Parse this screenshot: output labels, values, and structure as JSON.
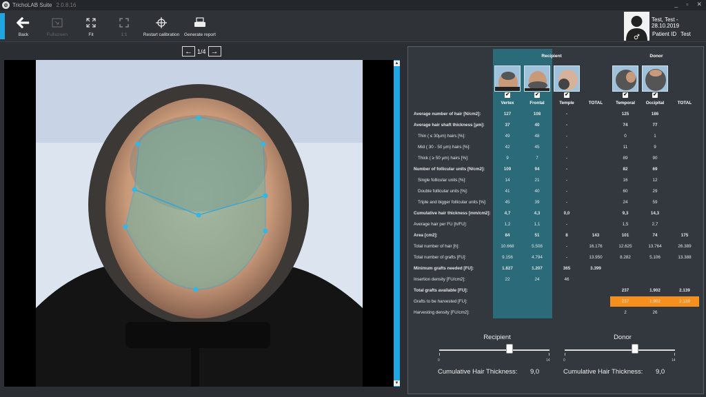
{
  "window": {
    "title": "TrichoLAB Suite",
    "version": "2.0.8.16",
    "controls": [
      "_",
      "▫",
      "✕"
    ]
  },
  "toolbar": {
    "back": "Back",
    "fullscreen": "Fullscreen",
    "fit": "Fit",
    "one_to_one": "1:1",
    "restart_calibration": "Restart calibration",
    "generate_report": "Generate report"
  },
  "patient": {
    "name_date": "Test, Test - 28.10.2019",
    "id_label": "Patient ID",
    "id_value": "Test"
  },
  "pager": {
    "text": "1/4"
  },
  "colors": {
    "accent": "#1ea7e0",
    "recipient_col": "#2a6a79",
    "highlight": "#f5901e"
  },
  "table": {
    "recipient_header": "Recipient",
    "donor_header": "Donor",
    "columns": [
      "Vertex",
      "Frontal",
      "Temple",
      "TOTAL",
      "Temporal",
      "Occipital",
      "TOTAL"
    ],
    "checkmarks": [
      "✔",
      "✔",
      "✔",
      "✔",
      "✔"
    ],
    "rows": [
      {
        "label": "Average number of hair [N/cm2]:",
        "bold": true,
        "sub": false,
        "values": [
          "127",
          "108",
          "-",
          "",
          "125",
          "186",
          ""
        ]
      },
      {
        "label": "Average hair shaft thickness [µm]:",
        "bold": true,
        "sub": false,
        "values": [
          "37",
          "40",
          "-",
          "",
          "74",
          "77",
          ""
        ]
      },
      {
        "label": "Thin ( ≤ 30µm) hairs [%]:",
        "bold": false,
        "sub": true,
        "values": [
          "49",
          "48",
          "-",
          "",
          "0",
          "1",
          ""
        ]
      },
      {
        "label": "Mid ( 30 - 50 µm) hairs [%]:",
        "bold": false,
        "sub": true,
        "values": [
          "42",
          "45",
          "-",
          "",
          "11",
          "9",
          ""
        ]
      },
      {
        "label": "Thick ( ≥ 50 µm) hairs [%]:",
        "bold": false,
        "sub": true,
        "values": [
          "9",
          "7",
          "-",
          "",
          "89",
          "90",
          ""
        ]
      },
      {
        "label": "Number of follicular units [N/cm2]:",
        "bold": true,
        "sub": false,
        "values": [
          "109",
          "94",
          "-",
          "",
          "82",
          "69",
          ""
        ]
      },
      {
        "label": "Single follicular units [%]:",
        "bold": false,
        "sub": true,
        "values": [
          "14",
          "21",
          "-",
          "",
          "16",
          "12",
          ""
        ]
      },
      {
        "label": "Double follicular units [%]:",
        "bold": false,
        "sub": true,
        "values": [
          "41",
          "40",
          "-",
          "",
          "60",
          "29",
          ""
        ]
      },
      {
        "label": "Triple and bigger follicular units [%]:",
        "bold": false,
        "sub": true,
        "values": [
          "45",
          "39",
          "-",
          "",
          "24",
          "59",
          ""
        ]
      },
      {
        "label": "Cumulative hair thickness [mm/cm2]:",
        "bold": true,
        "sub": false,
        "values": [
          "4,7",
          "4,3",
          "0,0",
          "",
          "9,3",
          "14,3",
          ""
        ]
      },
      {
        "label": "Average hair per FU [h/FU]:",
        "bold": false,
        "sub": false,
        "values": [
          "1,2",
          "1,1",
          "-",
          "",
          "1,5",
          "2,7",
          ""
        ]
      },
      {
        "label": "Area [cm2]:",
        "bold": true,
        "sub": false,
        "values": [
          "84",
          "51",
          "8",
          "143",
          "101",
          "74",
          "175"
        ]
      },
      {
        "label": "Total number of hair [h]:",
        "bold": false,
        "sub": false,
        "values": [
          "10.668",
          "5.508",
          "-",
          "16.176",
          "12.625",
          "13.764",
          "26.389"
        ]
      },
      {
        "label": "Total number of grafts [FU]:",
        "bold": false,
        "sub": false,
        "values": [
          "9.156",
          "4.794",
          "-",
          "13.950",
          "8.282",
          "5.106",
          "13.388"
        ]
      },
      {
        "label": "Minimum grafts needed [FU]:",
        "bold": true,
        "sub": false,
        "values": [
          "1.827",
          "1.207",
          "365",
          "3.399",
          "",
          "",
          ""
        ]
      },
      {
        "label": "Insertion density [FU/cm2]:",
        "bold": false,
        "sub": false,
        "values": [
          "22",
          "24",
          "46",
          "",
          "",
          "",
          ""
        ]
      },
      {
        "label": "Total grafts available [FU]:",
        "bold": true,
        "sub": false,
        "values": [
          "",
          "",
          "",
          "",
          "237",
          "1.902",
          "2.139"
        ]
      },
      {
        "label": "Grafts to be harvested [FU]:",
        "bold": false,
        "sub": false,
        "values": [
          "",
          "",
          "",
          "",
          "237",
          "1.902",
          "2.139"
        ]
      },
      {
        "label": "Harvesting density [FU/cm2]:",
        "bold": false,
        "sub": false,
        "values": [
          "",
          "",
          "",
          "",
          "2",
          "26",
          ""
        ]
      }
    ]
  },
  "sliders": {
    "recipient": {
      "title": "Recipient",
      "min": "0",
      "max": "14",
      "caption": "Cumulative Hair Thickness:",
      "value": "9,0",
      "level": 0.64
    },
    "donor": {
      "title": "Donor",
      "min": "0",
      "max": "14",
      "caption": "Cumulative Hair Thickness:",
      "value": "9,0",
      "level": 0.64
    }
  }
}
